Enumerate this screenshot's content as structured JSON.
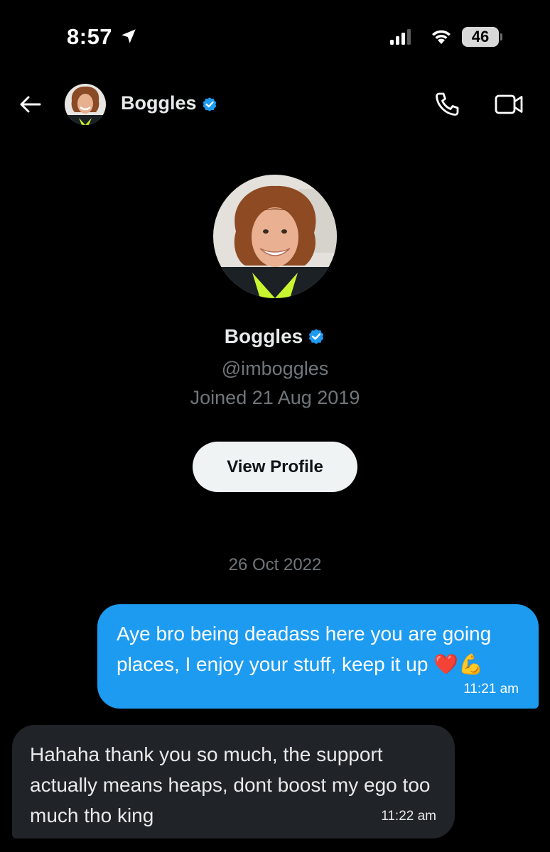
{
  "status_bar": {
    "time": "8:57",
    "battery": "46",
    "icons": [
      "location-arrow-icon",
      "cellular-signal-icon",
      "wifi-icon",
      "battery-icon"
    ]
  },
  "header": {
    "name": "Boggles",
    "icons": [
      "back-arrow-icon",
      "verified-badge-icon",
      "phone-call-icon",
      "video-call-icon"
    ]
  },
  "profile": {
    "name": "Boggles",
    "handle": "@imboggles",
    "joined": "Joined 21 Aug 2019",
    "view_profile_label": "View Profile"
  },
  "conversation": {
    "date_separator": "26 Oct 2022",
    "messages": [
      {
        "direction": "sent",
        "text": "Aye bro being deadass here you are going places, I enjoy your stuff, keep it up",
        "emoji": "❤️💪",
        "time": "11:21 am"
      },
      {
        "direction": "received",
        "text": "Hahaha thank you so much, the support actually means heaps, dont boost my ego too much tho king",
        "time": "11:22 am"
      }
    ]
  },
  "colors": {
    "background": "#000000",
    "accent": "#1d9bf0",
    "received_bubble": "#202327",
    "muted_text": "#71767b",
    "button_bg": "#eff3f4"
  }
}
